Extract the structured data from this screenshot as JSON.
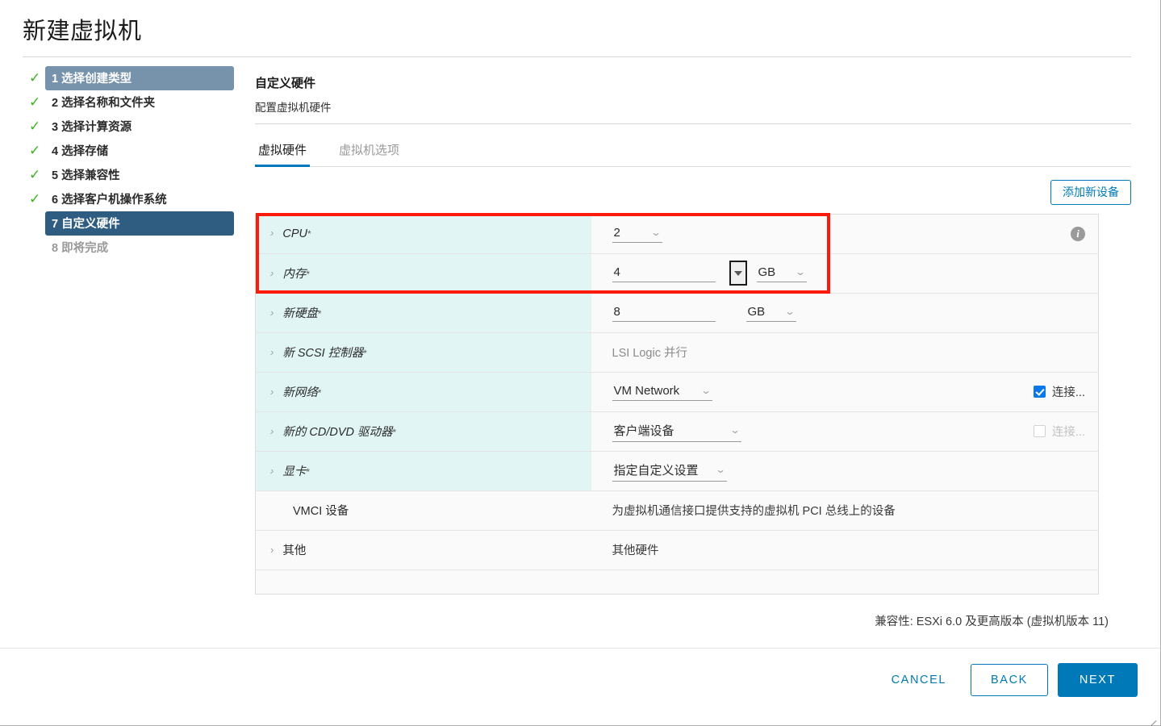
{
  "window": {
    "title": "新建虚拟机"
  },
  "steps": [
    {
      "num": "1",
      "label": "选择创建类型",
      "state": "done-highlight"
    },
    {
      "num": "2",
      "label": "选择名称和文件夹",
      "state": "done"
    },
    {
      "num": "3",
      "label": "选择计算资源",
      "state": "done"
    },
    {
      "num": "4",
      "label": "选择存储",
      "state": "done"
    },
    {
      "num": "5",
      "label": "选择兼容性",
      "state": "done"
    },
    {
      "num": "6",
      "label": "选择客户机操作系统",
      "state": "done"
    },
    {
      "num": "7",
      "label": "自定义硬件",
      "state": "active"
    },
    {
      "num": "8",
      "label": "即将完成",
      "state": "pending"
    }
  ],
  "panel": {
    "heading": "自定义硬件",
    "subheading": "配置虚拟机硬件"
  },
  "tabs": [
    {
      "label": "虚拟硬件",
      "selected": true
    },
    {
      "label": "虚拟机选项",
      "selected": false
    }
  ],
  "toolbar": {
    "add_device_label": "添加新设备"
  },
  "hardware_rows": [
    {
      "name": "CPU",
      "required_mark": "*",
      "italic": true,
      "expandable": true,
      "value": "2",
      "control": "number-select",
      "unit": null,
      "extra": "info-icon",
      "extra_label": ""
    },
    {
      "name": "内存",
      "required_mark": "*",
      "italic": true,
      "expandable": true,
      "value": "4",
      "control": "number-spinner",
      "unit": "GB",
      "extra": "none",
      "extra_label": ""
    },
    {
      "name": "新硬盘",
      "required_mark": "*",
      "italic": true,
      "expandable": true,
      "value": "8",
      "control": "number-unit",
      "unit": "GB",
      "extra": "none",
      "extra_label": ""
    },
    {
      "name": "新 SCSI 控制器",
      "required_mark": "*",
      "italic": true,
      "expandable": true,
      "value": "LSI Logic 并行",
      "control": "text-muted",
      "unit": null,
      "extra": "none",
      "extra_label": ""
    },
    {
      "name": "新网络",
      "required_mark": "*",
      "italic": true,
      "expandable": true,
      "value": "VM Network",
      "control": "select",
      "unit": null,
      "extra": "checkbox-checked",
      "extra_label": "连接..."
    },
    {
      "name": "新的 CD/DVD 驱动器",
      "required_mark": "*",
      "italic": true,
      "expandable": true,
      "value": "客户端设备",
      "control": "select-wide",
      "unit": null,
      "extra": "checkbox-disabled",
      "extra_label": "连接..."
    },
    {
      "name": "显卡",
      "required_mark": "*",
      "italic": true,
      "expandable": true,
      "value": "指定自定义设置",
      "control": "select",
      "unit": null,
      "extra": "none",
      "extra_label": ""
    },
    {
      "name": "VMCI 设备",
      "required_mark": "",
      "italic": false,
      "expandable": false,
      "value": "为虚拟机通信接口提供支持的虚拟机 PCI 总线上的设备",
      "control": "description",
      "unit": null,
      "extra": "none",
      "extra_label": ""
    },
    {
      "name": "其他",
      "required_mark": "",
      "italic": false,
      "expandable": true,
      "value": "其他硬件",
      "control": "description",
      "unit": null,
      "extra": "none",
      "extra_label": ""
    },
    {
      "name": "",
      "required_mark": "",
      "italic": false,
      "expandable": false,
      "value": "",
      "control": "empty",
      "unit": null,
      "extra": "none",
      "extra_label": ""
    }
  ],
  "footer": {
    "compatibility": "兼容性: ESXi 6.0 及更高版本 (虚拟机版本 11)",
    "cancel_label": "CANCEL",
    "back_label": "BACK",
    "next_label": "NEXT"
  },
  "annotation": {
    "highlight_color": "#fb1b0c",
    "highlight_rows": [
      "CPU",
      "内存"
    ]
  },
  "colors": {
    "accent": "#0079b8",
    "row_label_bg": "#e0f5f4",
    "step_active_bg": "#2f5d82",
    "step_top_bg": "#7792ab",
    "check_green": "#3cb521"
  }
}
